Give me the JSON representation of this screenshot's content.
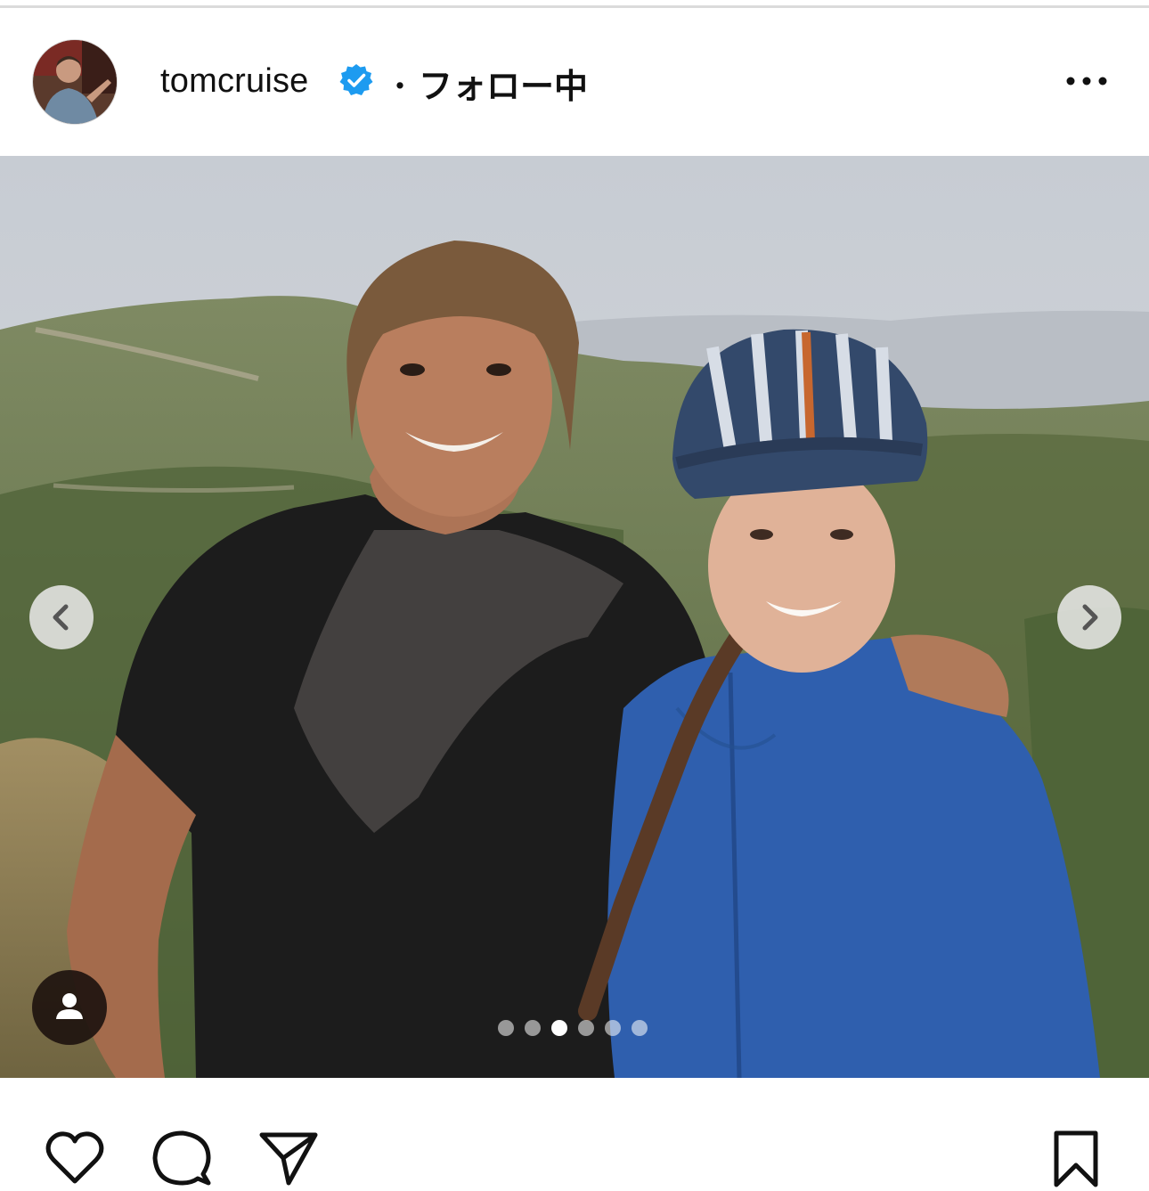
{
  "post": {
    "username": "tomcruise",
    "separator": "・",
    "follow_status": "フォロー中",
    "verified": true
  },
  "carousel": {
    "slide_count": 6,
    "active_index": 2
  },
  "icons": {
    "avatar": "avatar",
    "verified": "verified-badge-icon",
    "more": "more-options-icon",
    "prev": "chevron-left-icon",
    "next": "chevron-right-icon",
    "tag": "user-tag-icon",
    "like": "heart-icon",
    "comment": "comment-icon",
    "share": "send-icon",
    "save": "bookmark-icon"
  },
  "colors": {
    "verified_blue": "#1d9bf0",
    "text": "#111111",
    "divider": "#dbdbdb"
  }
}
